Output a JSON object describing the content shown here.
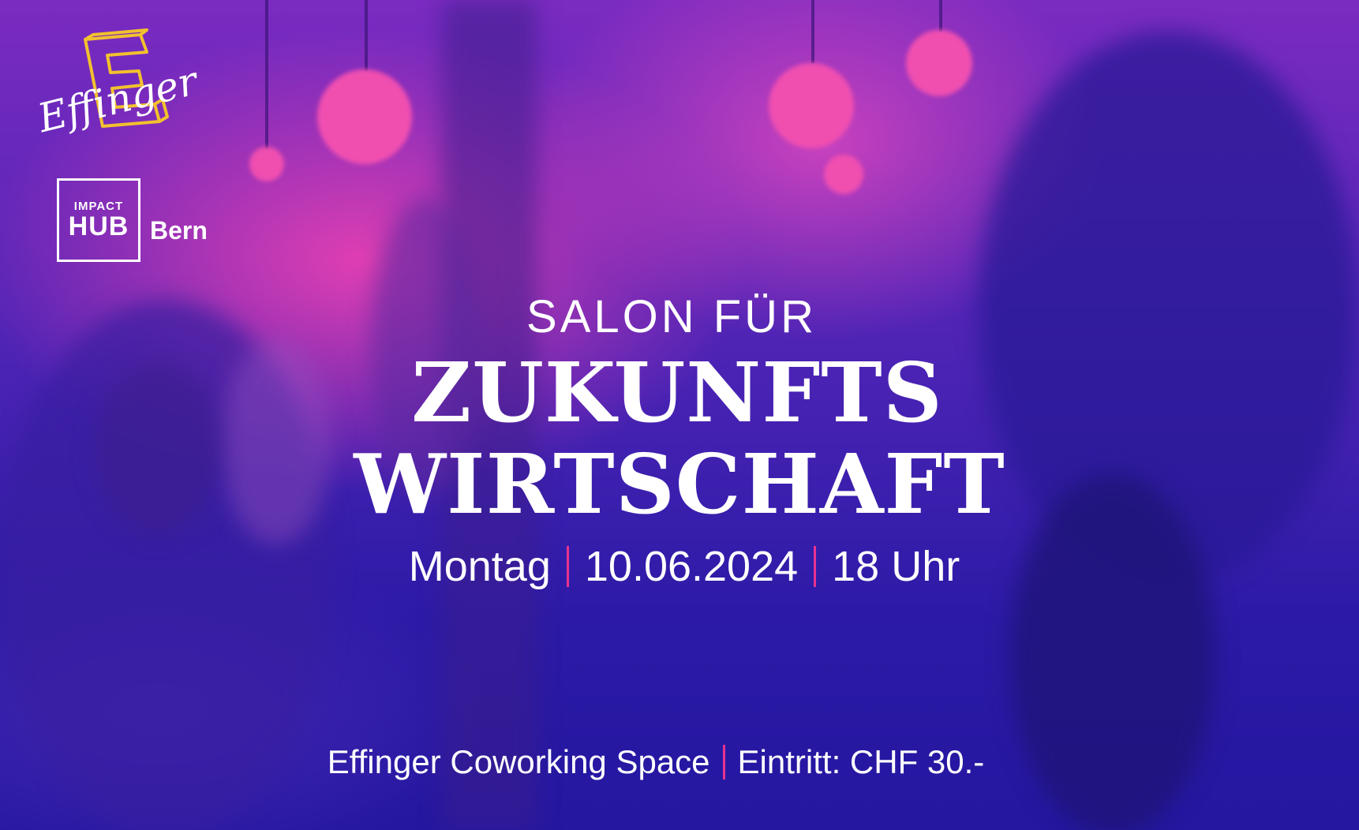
{
  "logos": {
    "effinger_wordmark": "Effinger",
    "impact_top": "IMPACT",
    "impact_hub": "HUB",
    "impact_city": "Bern"
  },
  "headline": {
    "kicker": "SALON FÜR",
    "line1": "ZUKUNFTS",
    "line2": "WIRTSCHAFT"
  },
  "event": {
    "day": "Montag",
    "date": "10.06.2024",
    "time": "18 Uhr",
    "location": "Effinger Coworking Space",
    "admission": "Eintritt: CHF 30.-"
  },
  "colors": {
    "accent": "#e8338f",
    "logo_yellow": "#f2c12e",
    "text": "#ffffff"
  }
}
